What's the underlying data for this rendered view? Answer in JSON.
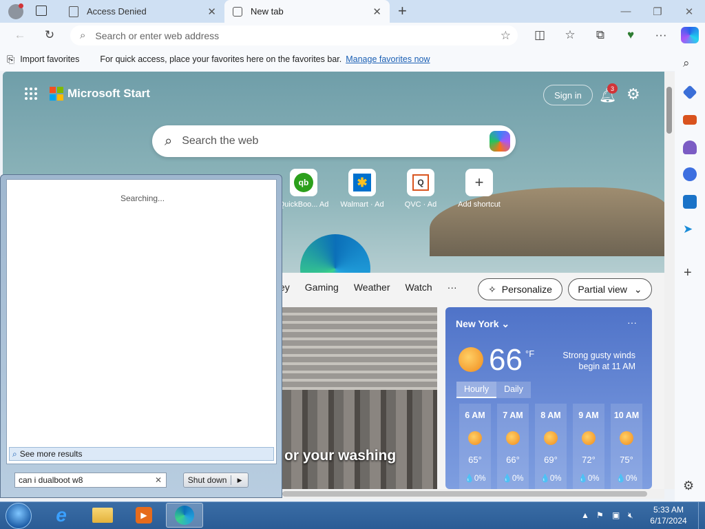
{
  "browser": {
    "tabs": [
      {
        "label": "Access Denied"
      },
      {
        "label": "New tab"
      }
    ],
    "address_placeholder": "Search or enter web address",
    "favorites_bar": {
      "import_label": "Import favorites",
      "message": "For quick access, place your favorites here on the favorites bar.",
      "link": "Manage favorites now"
    }
  },
  "newtab": {
    "brand": "Microsoft Start",
    "sign_in": "Sign in",
    "notification_count": "3",
    "search_placeholder": "Search the web",
    "tiles": [
      {
        "label": "QuickBoo... Ad",
        "glyph": "qb"
      },
      {
        "label": "Walmart · Ad",
        "glyph": "✱"
      },
      {
        "label": "QVC · Ad",
        "glyph": "Q"
      },
      {
        "label": "Add shortcut",
        "glyph": "+"
      }
    ],
    "feed_nav": [
      "ey",
      "Gaming",
      "Weather",
      "Watch",
      "···"
    ],
    "personalize": "Personalize",
    "partial_view": "Partial view",
    "article_caption": "or your washing"
  },
  "weather": {
    "city": "New York",
    "temp": "66",
    "unit": "°F",
    "alert": "Strong gusty winds begin at 11 AM",
    "tabs": [
      "Hourly",
      "Daily"
    ],
    "hours": [
      {
        "time": "6 AM",
        "temp": "65°",
        "precip": "💧0%"
      },
      {
        "time": "7 AM",
        "temp": "66°",
        "precip": "💧0%"
      },
      {
        "time": "8 AM",
        "temp": "69°",
        "precip": "💧0%"
      },
      {
        "time": "9 AM",
        "temp": "72°",
        "precip": "💧0%"
      },
      {
        "time": "10 AM",
        "temp": "75°",
        "precip": "💧0%"
      }
    ]
  },
  "start_menu": {
    "status": "Searching...",
    "see_more": "See more results",
    "query": "can i dualboot w8",
    "shutdown": "Shut down"
  },
  "taskbar": {
    "time": "5:33 AM",
    "date": "6/17/2024"
  },
  "colors": {
    "taskbar": "#2b5c95",
    "weather_card": "#5a7fd0",
    "link": "#1a5fb4",
    "badge": "#d13438"
  }
}
